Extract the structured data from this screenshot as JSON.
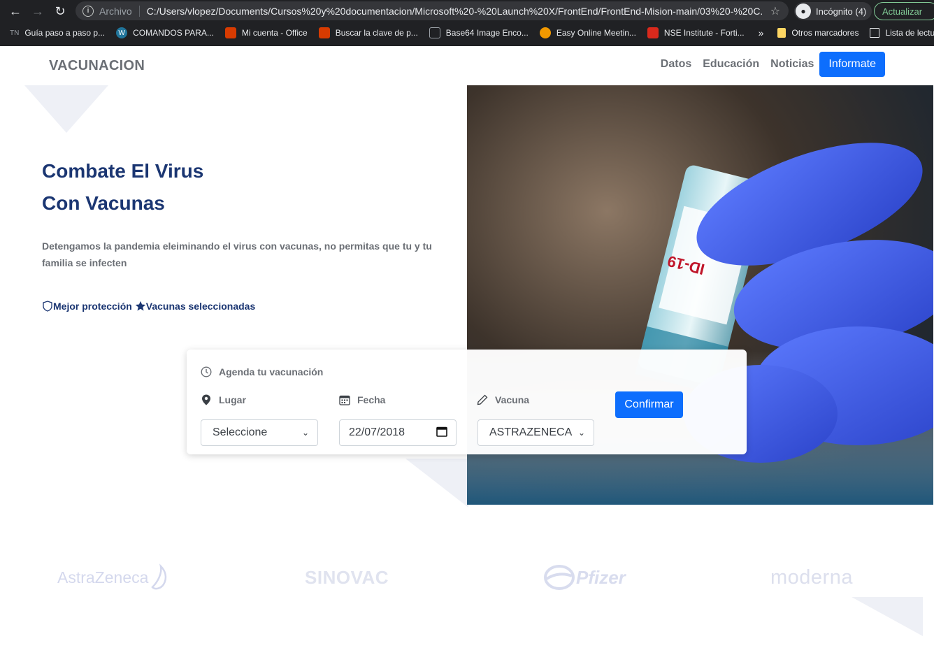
{
  "browser": {
    "scheme_label": "Archivo",
    "url": "C:/Users/vlopez/Documents/Cursos%20y%20documentacion/Microsoft%20-%20Launch%20X/FrontEnd/FrontEnd-Mision-main/03%20-%20C...",
    "incognito_label": "Incógnito (4)",
    "update_label": "Actualizar",
    "bookmarks": [
      {
        "label": "Guía paso a paso p...",
        "icon": "tn-icon",
        "color": "#5f6368"
      },
      {
        "label": "COMANDOS PARA...",
        "icon": "wordpress-icon",
        "color": "#21759b"
      },
      {
        "label": "Mi cuenta - Office",
        "icon": "office-icon",
        "color": "#d83b01"
      },
      {
        "label": "Buscar la clave de p...",
        "icon": "office-icon",
        "color": "#d83b01"
      },
      {
        "label": "Base64 Image Enco...",
        "icon": "image-icon",
        "color": "#5f6368"
      },
      {
        "label": "Easy Online Meetin...",
        "icon": "meeting-icon",
        "color": "#f29900"
      },
      {
        "label": "NSE Institute - Forti...",
        "icon": "fortinet-icon",
        "color": "#da291c"
      }
    ],
    "more_label": "»",
    "other_bookmarks": "Otros marcadores",
    "reading_list": "Lista de lectura"
  },
  "navbar": {
    "brand": "VACUNACION",
    "links": [
      "Datos",
      "Educación",
      "Noticias"
    ],
    "cta": "Informate"
  },
  "hero": {
    "title_line1": "Combate El Virus",
    "title_line2": "Con Vacunas",
    "description": "Detengamos la pandemia eleiminando el virus con vacunas, no permitas que tu y tu familia se infecten",
    "feature1": "Mejor protección",
    "feature2": "Vacunas seleccionadas"
  },
  "booking": {
    "title": "Agenda tu vacunación",
    "place_label": "Lugar",
    "place_value": "Seleccione",
    "date_label": "Fecha",
    "date_value": "22/07/2018",
    "vaccine_label": "Vacuna",
    "vaccine_value": "ASTRAZENECA",
    "confirm": "Confirmar"
  },
  "logos": [
    "AstraZeneca",
    "SINOVAC",
    "Pfizer",
    "moderna"
  ],
  "colors": {
    "primary": "#0d6efd",
    "heading": "#1b3672",
    "muted": "#6b6f75"
  }
}
